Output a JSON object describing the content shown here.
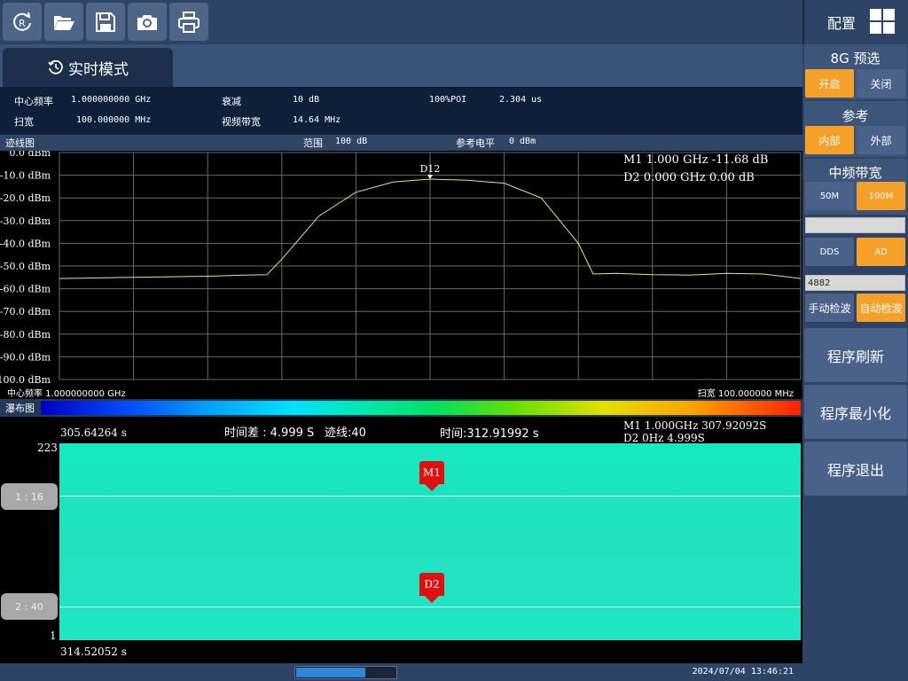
{
  "toolbar": {
    "icons": [
      "reset-icon",
      "folder-open-icon",
      "save-icon",
      "camera-icon",
      "printer-icon"
    ]
  },
  "config": {
    "label": "配置"
  },
  "tab": {
    "label": "实时模式"
  },
  "params": {
    "center_freq_label": "中心频率",
    "center_freq_value": "1.000000000 GHz",
    "span_label": "扫宽",
    "span_value": "100.000000 MHz",
    "atten_label": "衰减",
    "atten_value": "10 dB",
    "vbw_label": "视频带宽",
    "vbw_value": "14.64 MHz",
    "poi_label": "100%POI",
    "poi_value": "2.304 us"
  },
  "trace": {
    "title": "迹线图",
    "range_label": "范围",
    "range_value": "100 dB",
    "ref_label": "参考电平",
    "ref_value": "0 dBm",
    "y_ticks": [
      "0.0 dBm",
      "-10.0 dBm",
      "-20.0 dBm",
      "-30.0 dBm",
      "-40.0 dBm",
      "-50.0 dBm",
      "-60.0 dBm",
      "-70.0 dBm",
      "-80.0 dBm",
      "-90.0 dBm",
      "-100.0 dBm"
    ],
    "marker_label": "D12",
    "readout_m1": "M1 1.000 GHz -11.68 dB",
    "readout_d2": "D2 0.000 GHz 0.00 dB",
    "footer_center": "中心频率 1.000000000 GHz",
    "footer_span": "扫宽 100.000000 MHz",
    "colors": {
      "trace": "#e8e860",
      "grid": "#6a6a6a"
    }
  },
  "chart_data": {
    "type": "line",
    "xlabel": "",
    "ylabel": "",
    "xlim": [
      0.95,
      1.05
    ],
    "ylim": [
      -100,
      0
    ],
    "x": [
      0.95,
      0.96,
      0.97,
      0.975,
      0.978,
      0.98,
      0.985,
      0.99,
      0.995,
      1.0,
      1.005,
      1.01,
      1.015,
      1.02,
      1.022,
      1.025,
      1.03,
      1.035,
      1.04,
      1.045,
      1.05
    ],
    "series": [
      {
        "values": [
          -55.5,
          -55.0,
          -54.5,
          -54.0,
          -53.8,
          -47.0,
          -28.0,
          -17.5,
          -13.0,
          -11.7,
          -12.2,
          -13.5,
          -20.0,
          -40.0,
          -53.5,
          -53.2,
          -53.8,
          -54.0,
          -53.2,
          -53.5,
          -55.5
        ]
      }
    ]
  },
  "waterfall": {
    "title": "瀑布图",
    "top_time": "305.64264 s",
    "time_diff": "时间差 : 4.999 S",
    "trace_line": "迹线:40",
    "time_value": "时间:312.91992 s",
    "readout_m1": "M1 1.000GHz 307.92092S",
    "readout_d2": "D2 0Hz 4.999S",
    "y_top": "223",
    "y_bottom": "1",
    "bottom_time": "314.52052 s",
    "marker_m1": "M1",
    "marker_d2": "D2",
    "btn1": "1 : 16",
    "btn2": "2 : 40"
  },
  "status": {
    "datetime": "2024/07/04 13:46:21",
    "progress": 0.7
  },
  "panel": {
    "preselect_title": "8G 预选",
    "preselect_on": "开启",
    "preselect_off": "关闭",
    "ref_title": "参考",
    "ref_internal": "内部",
    "ref_external": "外部",
    "ifbw_title": "中频带宽",
    "ifbw_50": "50M",
    "ifbw_100": "100M",
    "field1": "",
    "dds": "DDS",
    "ad": "AD",
    "field2": "4882",
    "manual_detect": "手动检波",
    "auto_detect": "自动检波",
    "refresh": "程序刷新",
    "minimize": "程序最小化",
    "exit": "程序退出"
  }
}
